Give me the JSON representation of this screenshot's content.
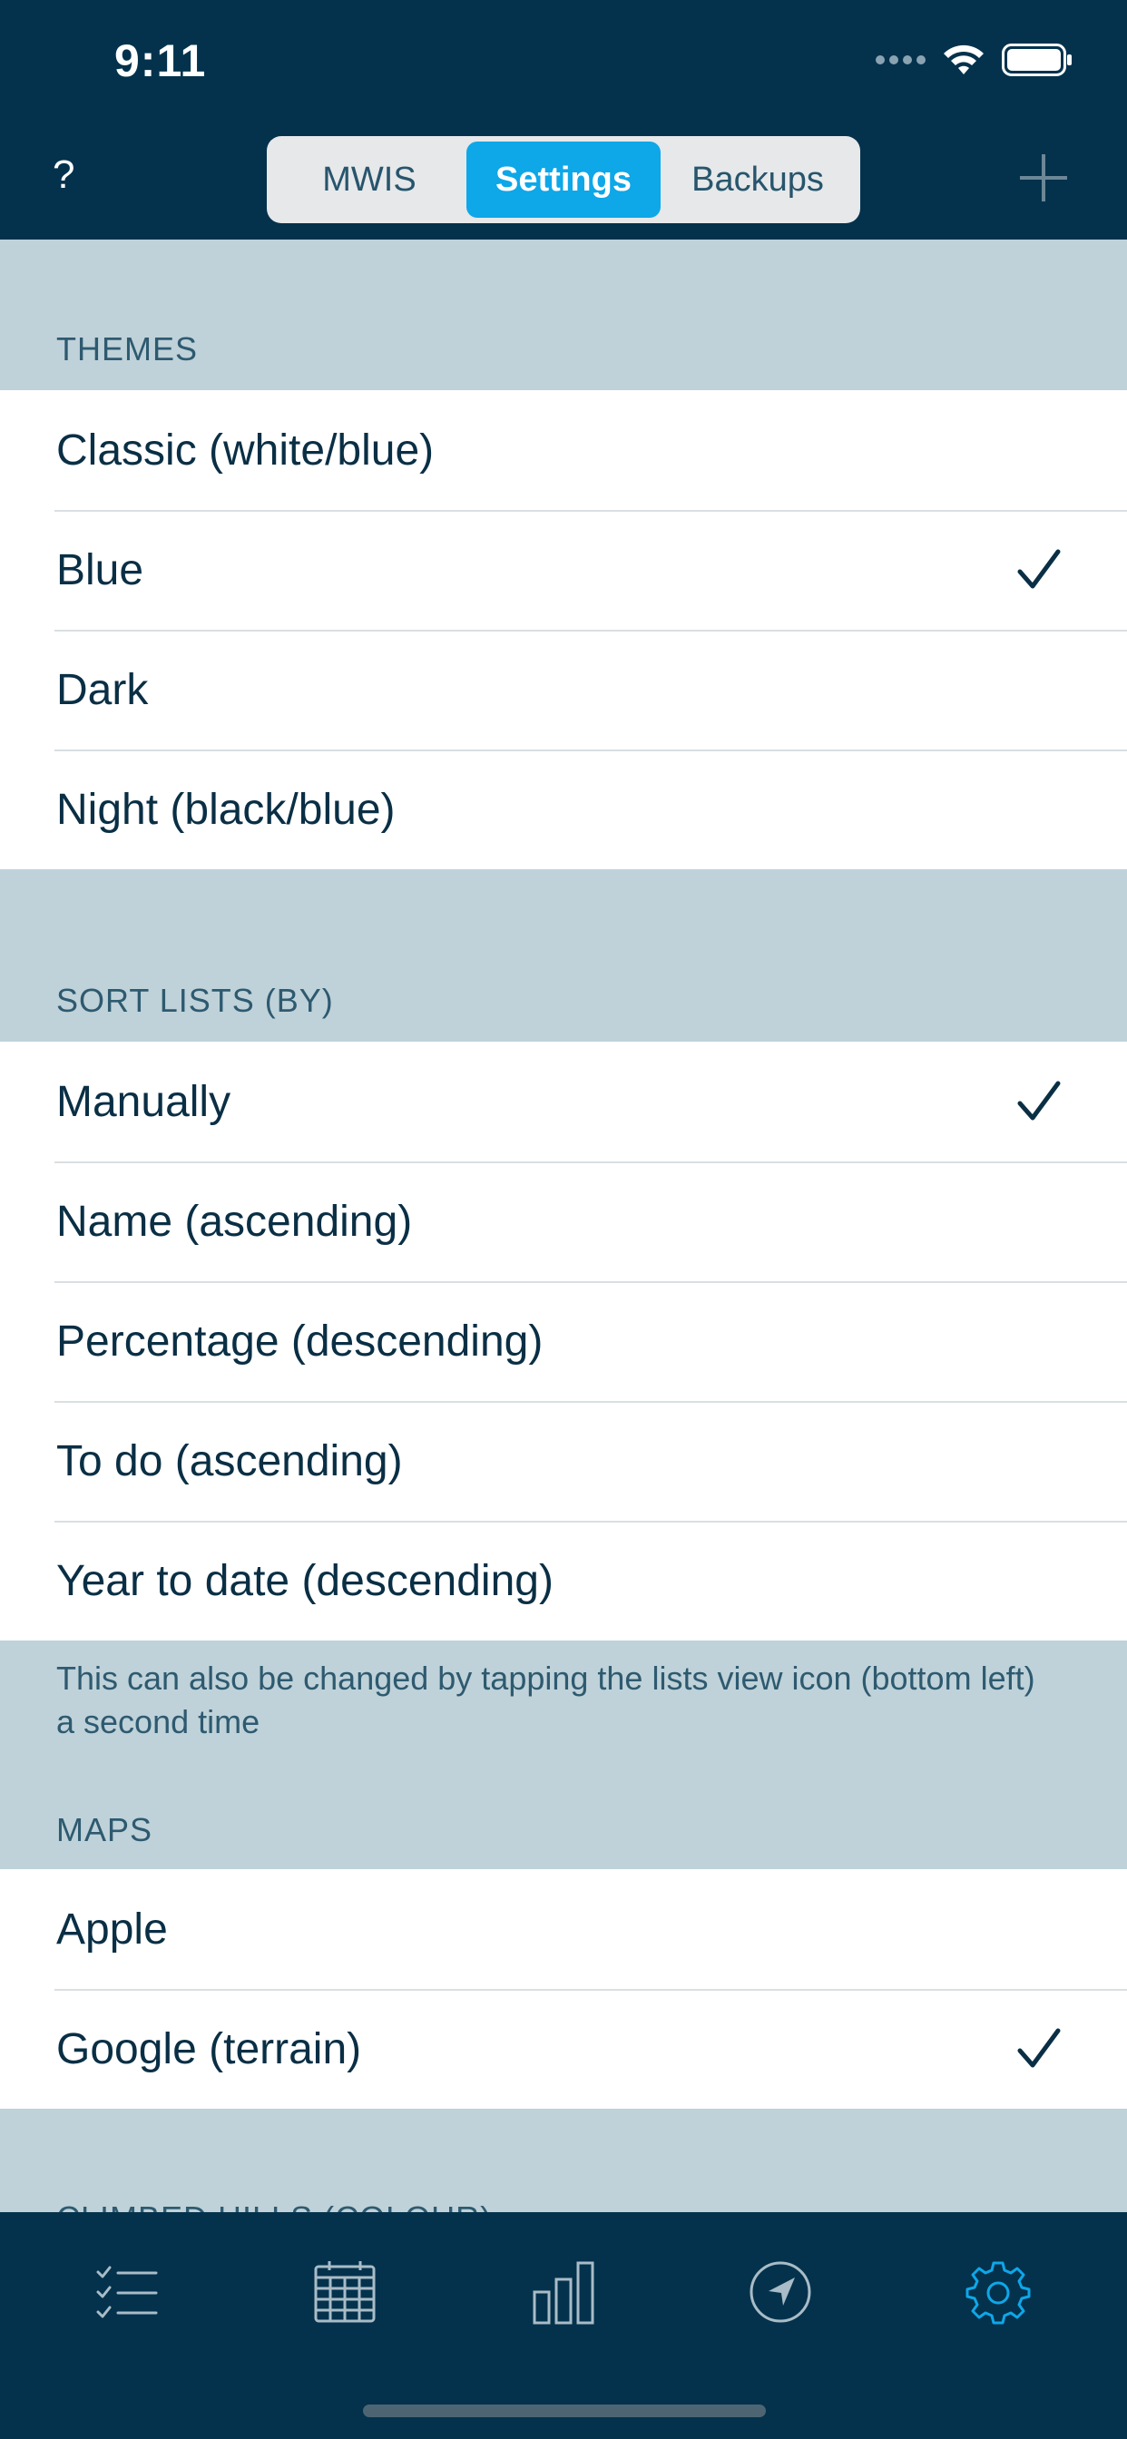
{
  "status_bar": {
    "time": "9:11"
  },
  "nav": {
    "help_label": "?",
    "segments": [
      {
        "label": "MWIS",
        "active": false
      },
      {
        "label": "Settings",
        "active": true
      },
      {
        "label": "Backups",
        "active": false
      }
    ],
    "add_icon": "plus-icon"
  },
  "themes": {
    "header": "THEMES",
    "items": [
      {
        "label": "Classic (white/blue)",
        "selected": false
      },
      {
        "label": "Blue",
        "selected": true
      },
      {
        "label": "Dark",
        "selected": false
      },
      {
        "label": "Night (black/blue)",
        "selected": false
      }
    ]
  },
  "sort_lists": {
    "header": "SORT LISTS (BY)",
    "items": [
      {
        "label": "Manually",
        "selected": true
      },
      {
        "label": "Name (ascending)",
        "selected": false
      },
      {
        "label": "Percentage (descending)",
        "selected": false
      },
      {
        "label": "To do (ascending)",
        "selected": false
      },
      {
        "label": "Year to date (descending)",
        "selected": false
      }
    ],
    "footer": "This can also be changed by tapping the lists view icon (bottom left) a second time"
  },
  "maps": {
    "header": "MAPS",
    "items": [
      {
        "label": "Apple",
        "selected": false
      },
      {
        "label": "Google (terrain)",
        "selected": true
      }
    ]
  },
  "next_section_header_partial": "CLIMBED HILLS (COLOUR)",
  "tab_bar": {
    "tabs": [
      {
        "icon": "checklist-icon",
        "active": false
      },
      {
        "icon": "calendar-icon",
        "active": false
      },
      {
        "icon": "bar-chart-icon",
        "active": false
      },
      {
        "icon": "location-arrow-icon",
        "active": false
      },
      {
        "icon": "gear-icon",
        "active": true
      }
    ]
  },
  "colors": {
    "header_bg": "#04324d",
    "group_bg": "#bfd2d9",
    "accent": "#0ea7e8",
    "text": "#0a2f45"
  }
}
